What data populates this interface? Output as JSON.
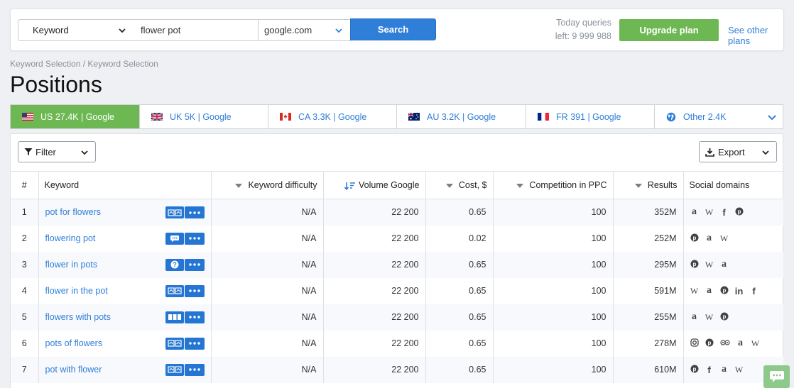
{
  "search": {
    "type_label": "Keyword",
    "query": "flower pot",
    "domain": "google.com",
    "button": "Search"
  },
  "queries": {
    "line1": "Today queries",
    "line2": "left: 9 999 988"
  },
  "upgrade": "Upgrade plan",
  "other_plans": "See other plans",
  "breadcrumb": "Keyword Selection / Keyword Selection",
  "title": "Positions",
  "tabs": [
    {
      "label": "US 27.4K | Google",
      "flag": "us-flag-icon"
    },
    {
      "label": "UK 5K | Google",
      "flag": "uk-flag-icon"
    },
    {
      "label": "CA 3.3K | Google",
      "flag": "ca-flag-icon"
    },
    {
      "label": "AU 3.2K | Google",
      "flag": "au-flag-icon"
    },
    {
      "label": "FR 391 | Google",
      "flag": "fr-flag-icon"
    },
    {
      "label": "Other 2.4K",
      "flag": "globe-icon"
    }
  ],
  "toolbar": {
    "filter": "Filter",
    "export": "Export"
  },
  "table": {
    "headers": [
      "#",
      "Keyword",
      "Keyword difficulty",
      "Volume Google",
      "Cost, $",
      "Competition in PPC",
      "Results",
      "Social domains"
    ],
    "rows": [
      {
        "n": "1",
        "kw": "pot for flowers",
        "diff": "N/A",
        "vol": "22 200",
        "cost": "0.65",
        "comp": "100",
        "res": "352M",
        "social": [
          "a",
          "W",
          "f",
          "P"
        ]
      },
      {
        "n": "2",
        "kw": "flowering pot",
        "diff": "N/A",
        "vol": "22 200",
        "cost": "0.02",
        "comp": "100",
        "res": "252M",
        "social": [
          "P",
          "a",
          "W"
        ]
      },
      {
        "n": "3",
        "kw": "flower in pots",
        "diff": "N/A",
        "vol": "22 200",
        "cost": "0.65",
        "comp": "100",
        "res": "295M",
        "social": [
          "P",
          "W",
          "a"
        ]
      },
      {
        "n": "4",
        "kw": "flower in the pot",
        "diff": "N/A",
        "vol": "22 200",
        "cost": "0.65",
        "comp": "100",
        "res": "591M",
        "social": [
          "W",
          "a",
          "P",
          "in",
          "f"
        ]
      },
      {
        "n": "5",
        "kw": "flowers with pots",
        "diff": "N/A",
        "vol": "22 200",
        "cost": "0.65",
        "comp": "100",
        "res": "255M",
        "social": [
          "a",
          "W",
          "P"
        ]
      },
      {
        "n": "6",
        "kw": "pots of flowers",
        "diff": "N/A",
        "vol": "22 200",
        "cost": "0.65",
        "comp": "100",
        "res": "278M",
        "social": [
          "IG",
          "P",
          "TA",
          "a",
          "W"
        ]
      },
      {
        "n": "7",
        "kw": "pot with flower",
        "diff": "N/A",
        "vol": "22 200",
        "cost": "0.65",
        "comp": "100",
        "res": "610M",
        "social": [
          "P",
          "f",
          "a",
          "W"
        ]
      }
    ]
  },
  "colors": {
    "accent_blue": "#2f7fd8",
    "accent_green": "#6db853",
    "action_blue": "#2576d3"
  }
}
